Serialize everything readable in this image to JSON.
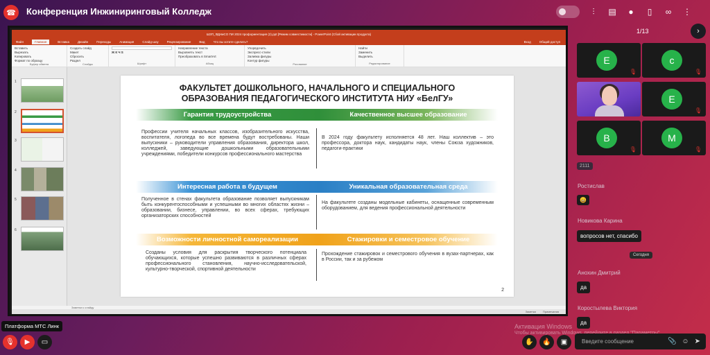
{
  "app": {
    "conference_title": "Конференция Инжиниринговый Колледж",
    "page_counter": "1/13",
    "platform_tooltip": "Платформа МТС Линк"
  },
  "ppt": {
    "window_title": "ШЗП_ФДНиСО ПИ 2024 профориентация (2).ppt [Режим совместимости] - PowerPoint (Сбой активации продукта)",
    "tabs": [
      "Файл",
      "Главная",
      "Вставка",
      "Дизайн",
      "Переходы",
      "Анимация",
      "Слайд-шоу",
      "Рецензирование",
      "Вид",
      "Что вы хотите сделать?"
    ],
    "active_tab": "Главная",
    "right_tabs": [
      "Вход",
      "Общий доступ"
    ],
    "groups": [
      "Буфер обмена",
      "Слайды",
      "Шрифт",
      "Абзац",
      "Рисование",
      "Редактирование"
    ],
    "buttons": [
      "Вставить",
      "Вырезать",
      "Копировать",
      "Формат по образцу",
      "Создать слайд",
      "Макет",
      "Сбросить",
      "Раздел",
      "Направление текста",
      "Выровнять текст",
      "Преобразовать в SmartArt",
      "Упорядочить",
      "Экспресс-стили",
      "Заливка фигуры",
      "Контур фигуры",
      "Эффекты фигуры",
      "Найти",
      "Заменить",
      "Выделить"
    ],
    "notes_placeholder": "Заметки к слайду",
    "status": [
      "Заметки",
      "Примечания"
    ],
    "thumb_numbers": [
      "1",
      "2",
      "3",
      "4",
      "5",
      "6"
    ]
  },
  "slide": {
    "title_line1": "ФАКУЛЬТЕТ ДОШКОЛЬНОГО, НАЧАЛЬНОГО И СПЕЦИАЛЬНОГО",
    "title_line2": "ОБРАЗОВАНИЯ ПЕДАГОГИЧЕСКОГО ИНСТИТУТА НИУ «БелГУ»",
    "h1": "Гарантия трудоустройства",
    "h2": "Качественное высшее образование",
    "h3": "Интересная работа в будущем",
    "h4": "Уникальная образовательная среда",
    "h5": "Возможности личностной самореализации",
    "h6": "Стажировки и семестровое обучение",
    "t1": "Профессии учителя начальных классов, изобразительного искусства, воспитателя, логопеда во все времена будут востребованы. Наши выпускники – руководители управления образования, директора школ, колледжей, заведующие дошкольными образовательными учреждениями, победители конкурсов профессионального мастерства",
    "t2": "В 2024 году факультету исполняется 48 лет. Наш коллектив – это профессора, доктора наук, кандидаты наук, члены Союза художников, педагоги-практики",
    "t3": "Полученное в стенах факультета образование позволяет выпускникам быть конкурентоспособными и успешными во многих областях жизни – образовании, бизнесе, управлении, во всех сферах, требующих организаторских способностей",
    "t4": "На факультете созданы модельные кабинеты, оснащенные современным оборудованием, для ведения профессиональной деятельности",
    "t5": "Созданы условия для раскрытия творческого потенциала обучающихся, которые успешно развиваются в различных сферах профессионального становления, научно-исследовательской, культурно-творческой, спортивной деятельности",
    "t6": "Прохождение стажировок и семестрового обучения в вузах-партнерах, как в России, так и за рубежом",
    "number": "2"
  },
  "participants": {
    "initials": [
      "E",
      "c",
      "E",
      "B",
      "M"
    ]
  },
  "chat": {
    "badge": "2111",
    "messages": [
      {
        "author": "Ростислав",
        "text": "😀"
      },
      {
        "author": "Новикова Карина",
        "text": "вопросов нет, спасибо"
      },
      {
        "author": "Анохин Дмитрий",
        "text": "да"
      },
      {
        "author": "Коростылева Виктория",
        "text": "да"
      }
    ],
    "date_chip": "Сегодня",
    "input_placeholder": "Введите сообщение"
  },
  "watermark": {
    "line1": "Активация Windows",
    "line2": "Чтобы активировать Windows, перейдите в раздел \"Параметры\"."
  },
  "colors": {
    "accent_red": "#e5322d",
    "ppt_orange": "#c43e1c",
    "green_band": "#2f8f3a",
    "blue_band": "#2a7fc5",
    "orange_band": "#f0a21a"
  }
}
